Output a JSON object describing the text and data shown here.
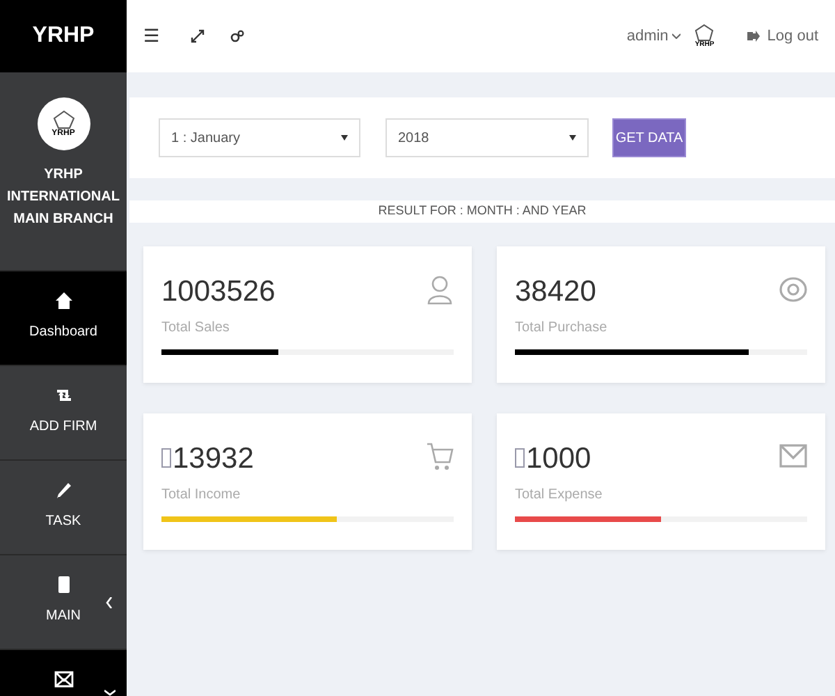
{
  "brand": "YRHP",
  "profile": {
    "logo_text": "YRHP",
    "name_lines": [
      "YRHP",
      "INTERNATIONAL",
      "MAIN BRANCH"
    ]
  },
  "nav": [
    {
      "kind": "home",
      "label": "Dashboard",
      "selected": true
    },
    {
      "kind": "repeat",
      "label": "ADD FIRM",
      "selected": false
    },
    {
      "kind": "pencil",
      "label": "TASK",
      "selected": false
    },
    {
      "kind": "book",
      "label": "MAIN",
      "selected": false,
      "expanded": false
    },
    {
      "kind": "envelope",
      "selected": true,
      "expanded": true
    }
  ],
  "header": {
    "menu_glyph": "☰",
    "user": "admin",
    "user_logo_text": "YRHP",
    "logout": "Log out"
  },
  "filters": {
    "month": "1 : January",
    "year": "2018",
    "button": "GET DATA"
  },
  "result_text": "RESULT FOR : MONTH : AND YEAR",
  "cards": [
    {
      "kind": "user",
      "value": "1003526",
      "label": "Total Sales",
      "level": 0.4,
      "color": "#000000",
      "currency_box": false
    },
    {
      "kind": "eye",
      "value": "38420",
      "label": "Total Purchase",
      "level": 0.8,
      "color": "#000000",
      "currency_box": false
    },
    {
      "kind": "cart",
      "value": "13932",
      "label": "Total Income",
      "level": 0.6,
      "color": "#f0c419",
      "currency_box": true
    },
    {
      "kind": "envelope",
      "value": "1000",
      "label": "Total Expense",
      "level": 0.5,
      "color": "#e84a4a",
      "currency_box": true
    }
  ]
}
